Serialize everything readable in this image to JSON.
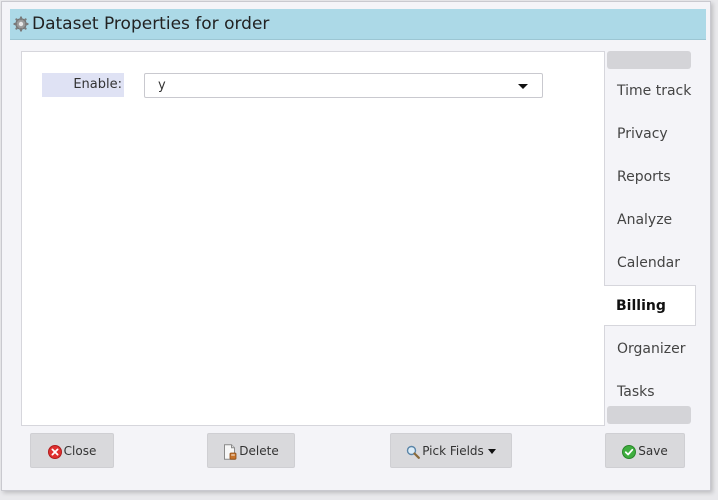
{
  "dialog": {
    "title": "Dataset Properties for order",
    "title_icon": "gear-icon"
  },
  "form": {
    "enable_label": "Enable:",
    "enable_value": "y"
  },
  "tabs": [
    {
      "label": "Time track",
      "active": false
    },
    {
      "label": "Privacy",
      "active": false
    },
    {
      "label": "Reports",
      "active": false
    },
    {
      "label": "Analyze",
      "active": false
    },
    {
      "label": "Calendar",
      "active": false
    },
    {
      "label": "Billing",
      "active": true
    },
    {
      "label": "Organizer",
      "active": false
    },
    {
      "label": "Tasks",
      "active": false
    }
  ],
  "buttons": {
    "close": "Close",
    "delete": "Delete",
    "pick_fields": "Pick Fields",
    "save": "Save"
  },
  "colors": {
    "title_bar": "#acd9e7",
    "label_bg": "#dfe2f4",
    "close_icon": "#e03030",
    "save_icon": "#3fae3f"
  }
}
